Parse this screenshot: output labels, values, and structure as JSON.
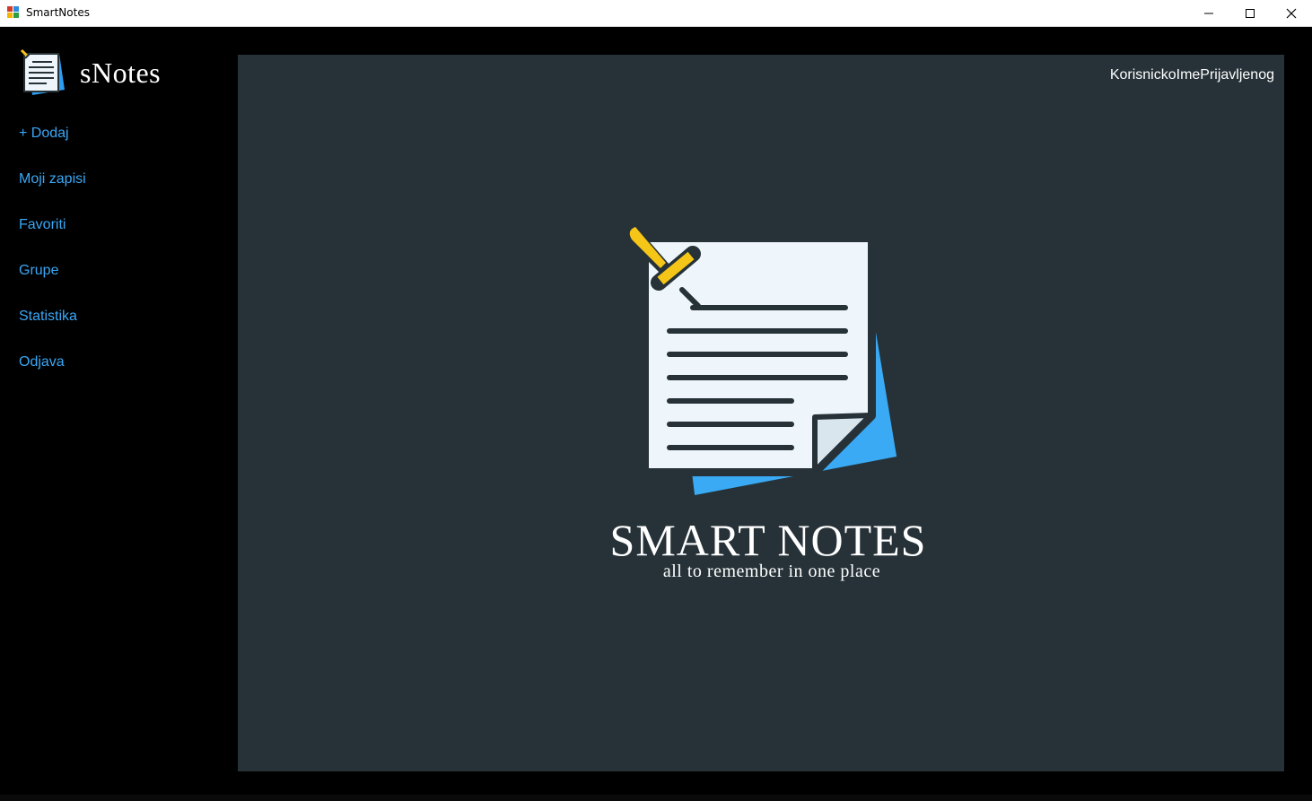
{
  "window": {
    "title": "SmartNotes",
    "controls": {
      "minimize": "minimize-icon",
      "maximize": "maximize-icon",
      "close": "close-icon"
    }
  },
  "sidebar": {
    "brand": "sNotes",
    "items": [
      {
        "label": "+ Dodaj"
      },
      {
        "label": "Moji zapisi"
      },
      {
        "label": "Favoriti"
      },
      {
        "label": "Grupe"
      },
      {
        "label": "Statistika"
      },
      {
        "label": "Odjava"
      }
    ]
  },
  "main": {
    "username": "KorisnickoImePrijavljenog",
    "hero_title": "SMART NOTES",
    "hero_subtitle": "all to remember in one place"
  },
  "colors": {
    "background": "#000000",
    "panel": "#263238",
    "accent": "#3aa7f5",
    "text": "#ffffff",
    "pin": "#f5c518"
  }
}
